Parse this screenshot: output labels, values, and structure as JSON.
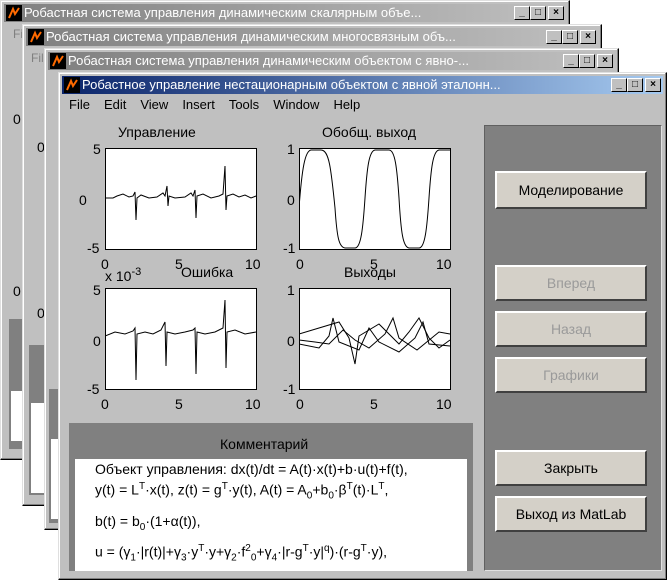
{
  "windows": {
    "w1": {
      "title": "Робастная система управления динамическим скалярным объе..."
    },
    "w2": {
      "title": "Робастная система управления динамическим многосвязным объ..."
    },
    "w3": {
      "title": "Робастная система управления динамическим объектом с явно-..."
    },
    "main": {
      "title": "Робастное управление нестационарным объектом  с  явной эталонн..."
    }
  },
  "window_buttons": {
    "minimize": "_",
    "maximize": "□",
    "close": "×"
  },
  "background_fragments": {
    "w1_menu": "Fi",
    "w2_menu": "Fil",
    "w1_zero": "0",
    "w1_zero2": "0",
    "w2_zero": "0",
    "w2_zero2": "0"
  },
  "menu": [
    "File",
    "Edit",
    "View",
    "Insert",
    "Tools",
    "Window",
    "Help"
  ],
  "plots": {
    "control": {
      "title": "Управление",
      "yticks": [
        "5",
        "0",
        "-5"
      ],
      "xticks": [
        "0",
        "5",
        "10"
      ]
    },
    "output": {
      "title": "Обобщ. выход",
      "yticks": [
        "1",
        "0",
        "-1"
      ],
      "xticks": [
        "0",
        "5",
        "10"
      ]
    },
    "error": {
      "title": "Ошибка",
      "scale": "x 10",
      "scale_exp": "-3",
      "yticks": [
        "5",
        "0",
        "-5"
      ],
      "xticks": [
        "0",
        "5",
        "10"
      ]
    },
    "outputs": {
      "title": "Выходы",
      "yticks": [
        "1",
        "0",
        "-1"
      ],
      "xticks": [
        "0",
        "5",
        "10"
      ]
    }
  },
  "buttons": {
    "simulate": "Моделирование",
    "forward": "Вперед",
    "back": "Назад",
    "graphs": "Графики",
    "close": "Закрыть",
    "exit": "Выход из MatLab"
  },
  "comment": {
    "title": "Комментарий",
    "line1": "Объект управления: dx(t)/dt = A(t)·x(t)+b·u(t)+f(t),",
    "line2": "y(t) = L",
    "line3": "b(t) = b",
    "line4": "u = (γ"
  }
}
